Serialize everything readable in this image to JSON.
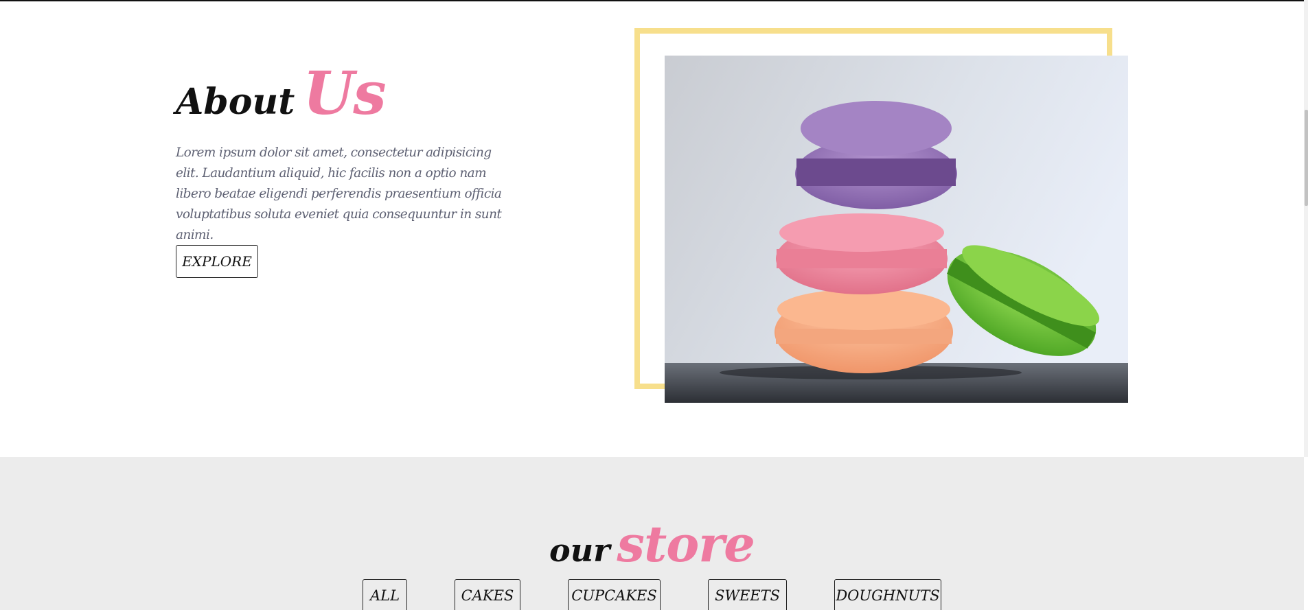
{
  "about": {
    "heading_word1": "About",
    "heading_word2": "Us",
    "paragraph": "Lorem ipsum dolor sit amet, consectetur adipisicing elit. Laudantium aliquid, hic facilis non a optio nam libero beatae eligendi perferendis praesentium officia voluptatibus soluta eveniet quia consequuntur in sunt animi.",
    "explore_label": "EXPLORE",
    "image_subject": "stacked macarons"
  },
  "store": {
    "heading_word1": "our",
    "heading_word2": "store",
    "filters": [
      "ALL",
      "CAKES",
      "CUPCAKES",
      "SWEETS",
      "DOUGHNUTS"
    ]
  },
  "colors": {
    "accent_pink": "#ee7aa0",
    "frame_yellow": "#f7df8c",
    "store_background": "#ececec",
    "paragraph_text": "#5e6173"
  }
}
